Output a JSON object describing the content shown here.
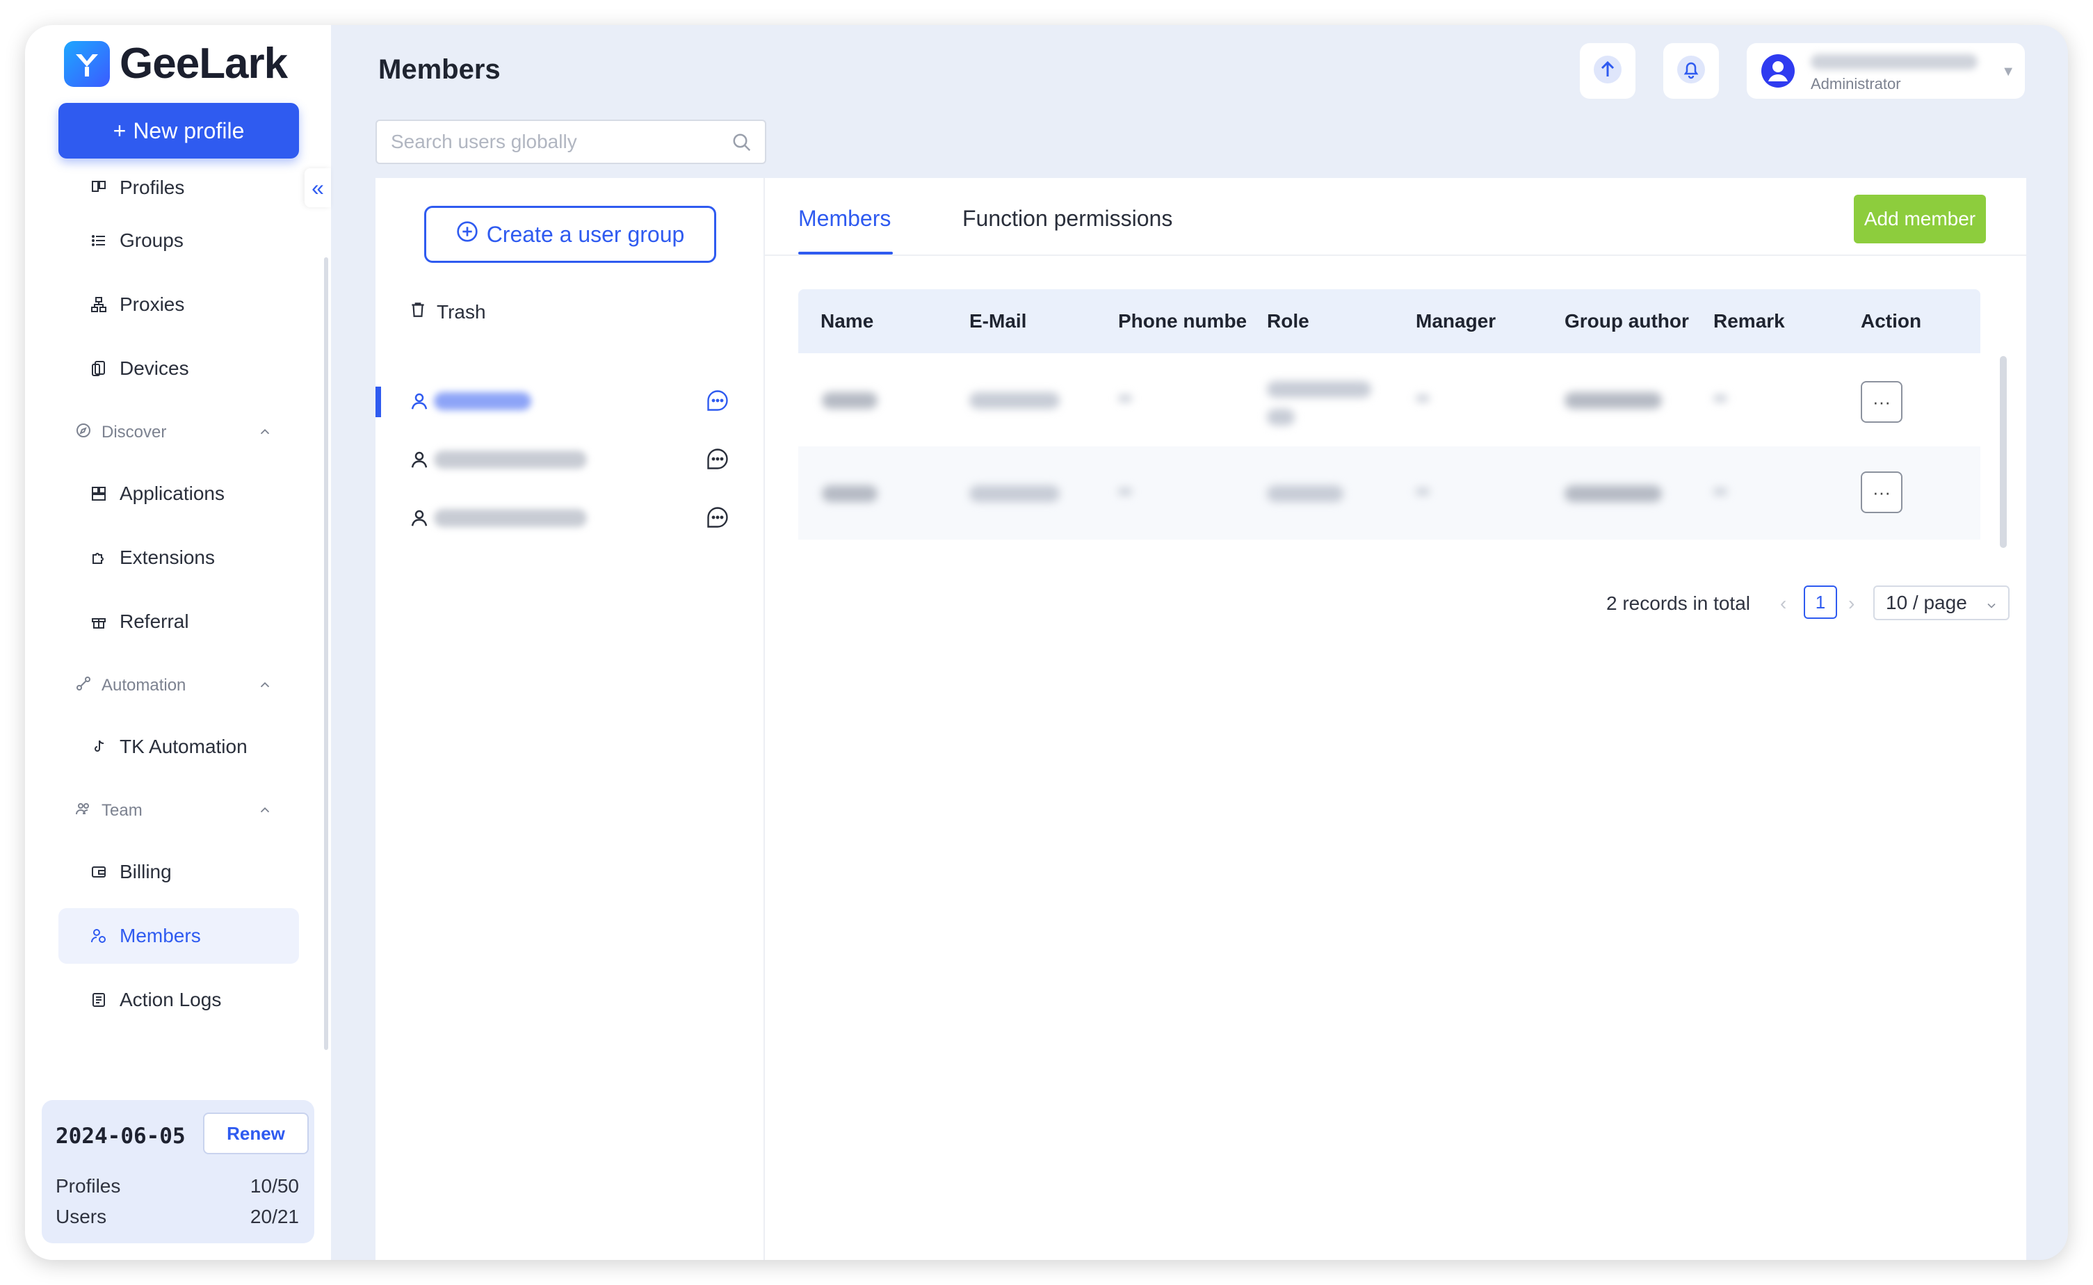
{
  "app": {
    "name": "GeeLark",
    "new_profile_label": "New profile"
  },
  "sidebar": {
    "items": [
      {
        "label": "Profiles",
        "icon": "profiles-icon"
      },
      {
        "label": "Groups",
        "icon": "list-icon"
      },
      {
        "label": "Proxies",
        "icon": "proxy-icon"
      },
      {
        "label": "Devices",
        "icon": "devices-icon"
      },
      {
        "label": "Discover",
        "icon": "discover-icon",
        "section": true
      },
      {
        "label": "Applications",
        "icon": "applications-icon"
      },
      {
        "label": "Extensions",
        "icon": "puzzle-icon"
      },
      {
        "label": "Referral",
        "icon": "gift-icon"
      },
      {
        "label": "Automation",
        "icon": "automation-icon",
        "section": true
      },
      {
        "label": "TK Automation",
        "icon": "tiktok-icon"
      },
      {
        "label": "Team",
        "icon": "team-icon",
        "section": true
      },
      {
        "label": "Billing",
        "icon": "wallet-icon"
      },
      {
        "label": "Members",
        "icon": "members-icon",
        "active": true
      },
      {
        "label": "Action Logs",
        "icon": "document-icon"
      }
    ]
  },
  "plan": {
    "expiry_date": "2024-06-05",
    "renew_label": "Renew",
    "profiles_label": "Profiles",
    "profiles_value": "10/50",
    "users_label": "Users",
    "users_value": "20/21"
  },
  "header": {
    "title": "Members",
    "user_role": "Administrator"
  },
  "search": {
    "placeholder": "Search users globally"
  },
  "groups": {
    "create_label": "Create a user group",
    "trash_label": "Trash"
  },
  "tabs": [
    {
      "label": "Members",
      "active": true
    },
    {
      "label": "Function permissions",
      "active": false
    }
  ],
  "add_member_label": "Add member",
  "table": {
    "columns": [
      "Name",
      "E-Mail",
      "Phone numbe",
      "Role",
      "Manager",
      "Group author",
      "Remark",
      "Action"
    ],
    "action_label": "···"
  },
  "pagination": {
    "total_label": "2 records in total",
    "current_page": "1",
    "page_size": "10 / page"
  },
  "colors": {
    "primary": "#2f5bf0",
    "add_member": "#8dcd3d",
    "app_background": "#e9eef8"
  }
}
